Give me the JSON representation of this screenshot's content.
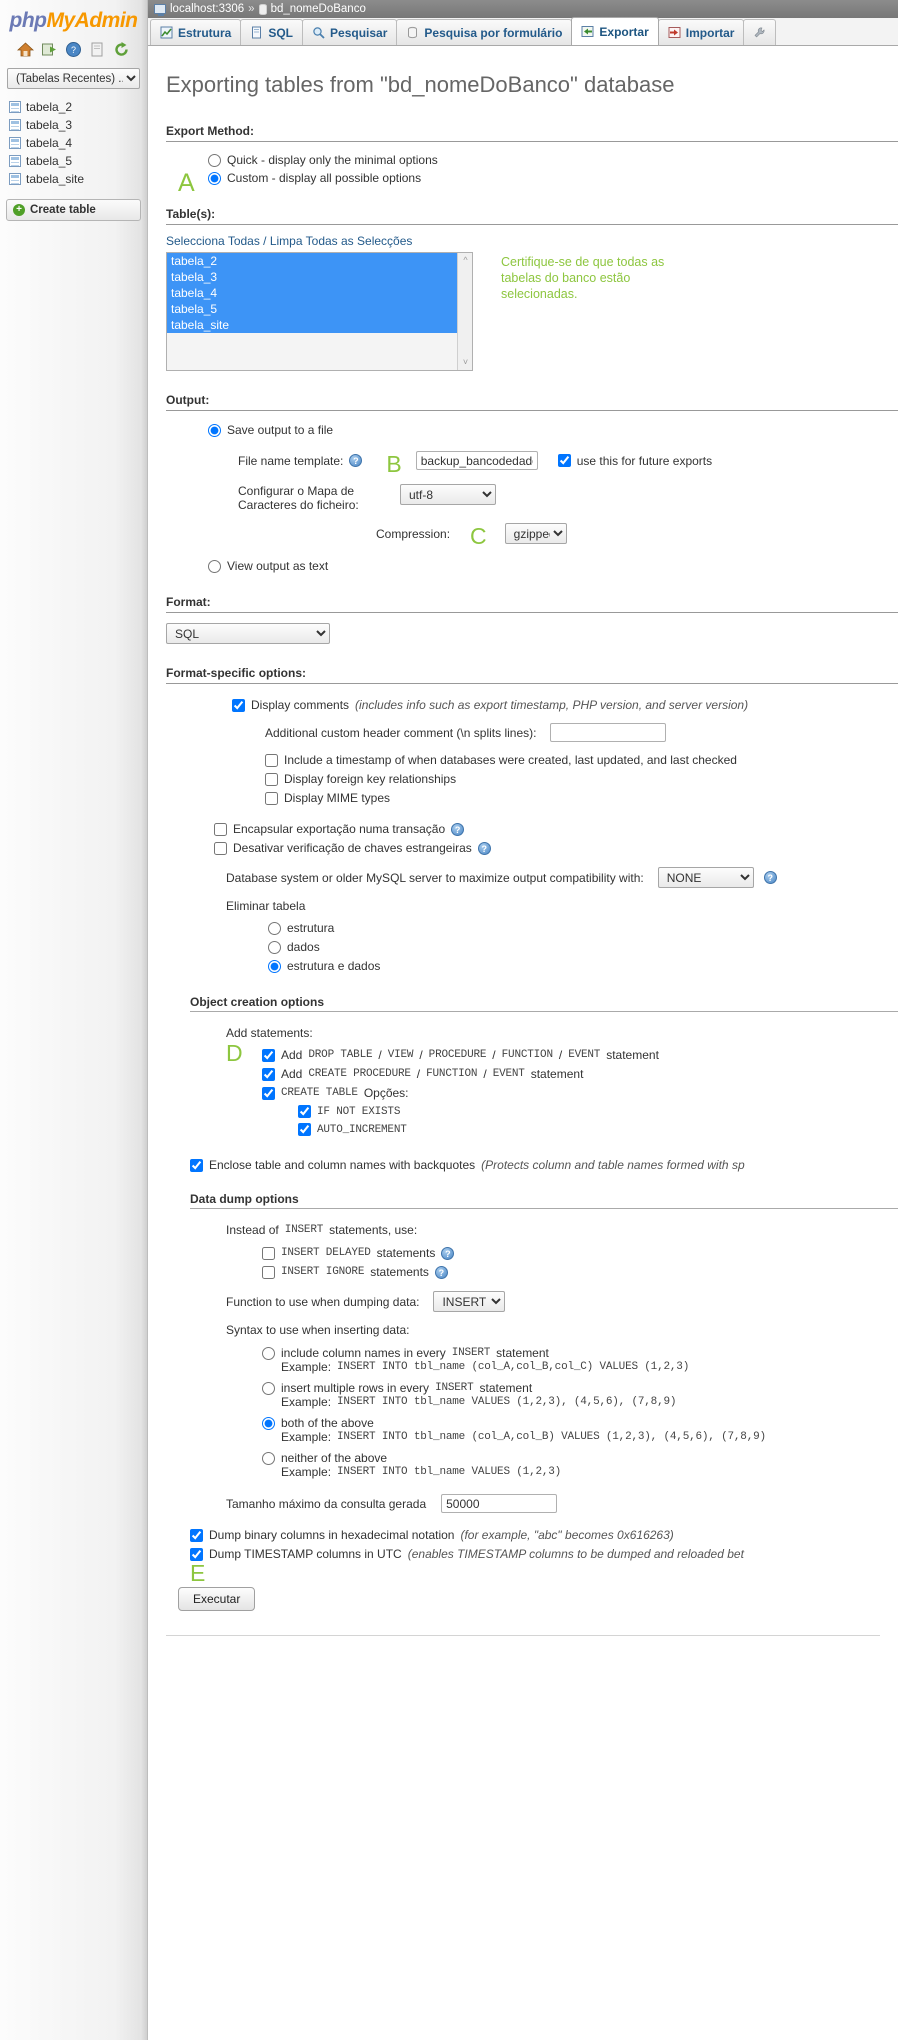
{
  "sidebar": {
    "logo": {
      "php": "php",
      "my": "My",
      "admin": "Admin"
    },
    "nav_icons": [
      "home-icon",
      "logout-icon",
      "help-icon",
      "docs-icon",
      "reload-icon"
    ],
    "recent_select": "(Tabelas Recentes) ...",
    "tables": [
      "tabela_2",
      "tabela_3",
      "tabela_4",
      "tabela_5",
      "tabela_site"
    ],
    "create_table": "Create table"
  },
  "breadcrumb": {
    "server": "localhost:3306",
    "separator": "»",
    "database": "bd_nomeDoBanco"
  },
  "tabs": [
    {
      "label": "Estrutura",
      "icon": "structure-icon",
      "active": false
    },
    {
      "label": "SQL",
      "icon": "sql-icon",
      "active": false
    },
    {
      "label": "Pesquisar",
      "icon": "search-icon",
      "active": false
    },
    {
      "label": "Pesquisa por formulário",
      "icon": "query-form-icon",
      "active": false
    },
    {
      "label": "Exportar",
      "icon": "export-icon",
      "active": true
    },
    {
      "label": "Importar",
      "icon": "import-icon",
      "active": false
    }
  ],
  "page_title": "Exporting tables from \"bd_nomeDoBanco\" database",
  "export_method": {
    "heading": "Export Method:",
    "quick": "Quick - display only the minimal options",
    "custom": "Custom - display all possible options",
    "selected": "custom"
  },
  "tables_section": {
    "heading": "Table(s):",
    "select_all_link": "Selecciona Todas / Limpa Todas as Selecções",
    "options": [
      "tabela_2",
      "tabela_3",
      "tabela_4",
      "tabela_5",
      "tabela_site"
    ],
    "annotation": "Certifique-se de que todas as tabelas do banco estão selecionadas."
  },
  "output": {
    "heading": "Output:",
    "save_to_file": "Save output to a file",
    "file_name_template_label": "File name template:",
    "file_name_template_value": "backup_bancodedados",
    "use_future": "use this for future exports",
    "charset_label": "Configurar o Mapa de Caracteres do ficheiro:",
    "charset_value": "utf-8",
    "compression_label": "Compression:",
    "compression_value": "gzipped",
    "view_as_text": "View output as text"
  },
  "format": {
    "heading": "Format:",
    "value": "SQL"
  },
  "format_specific": {
    "heading": "Format-specific options:",
    "display_comments": "Display comments",
    "display_comments_note": "(includes info such as export timestamp, PHP version, and server version)",
    "additional_header_label": "Additional custom header comment (\\n splits lines):",
    "additional_header_value": "",
    "include_timestamp": "Include a timestamp of when databases were created, last updated, and last checked",
    "foreign_key": "Display foreign key relationships",
    "mime_types": "Display MIME types",
    "encapsular": "Encapsular exportação numa transação",
    "desativar": "Desativar verificação de chaves estrangeiras",
    "compat_label": "Database system or older MySQL server to maximize output compatibility with:",
    "compat_value": "NONE",
    "eliminar_tabela": "Eliminar tabela",
    "estrutura": "estrutura",
    "dados": "dados",
    "estrutura_e_dados": "estrutura e dados",
    "eliminar_selected": "estrutura e dados"
  },
  "object_creation": {
    "heading": "Object creation options",
    "add_statements": "Add statements:",
    "drop_pre": "Add",
    "drop_mono1": "DROP TABLE",
    "drop_sep1": "/",
    "drop_mono2": "VIEW",
    "drop_sep2": "/",
    "drop_mono3": "PROCEDURE",
    "drop_sep3": "/",
    "drop_mono4": "FUNCTION",
    "drop_sep4": "/",
    "drop_mono5": "EVENT",
    "drop_post": "statement",
    "create_pre": "Add",
    "create_mono1": "CREATE PROCEDURE",
    "create_sep1": "/",
    "create_mono2": "FUNCTION",
    "create_sep2": "/",
    "create_mono3": "EVENT",
    "create_post": "statement",
    "create_table_opts_mono": "CREATE TABLE",
    "create_table_opts_post": "Opções:",
    "if_not_exists": "IF NOT EXISTS",
    "auto_increment": "AUTO_INCREMENT",
    "backquotes": "Enclose table and column names with backquotes",
    "backquotes_note": "(Protects column and table names formed with sp"
  },
  "data_dump": {
    "heading": "Data dump options",
    "instead_pre": "Instead of",
    "instead_mono": "INSERT",
    "instead_post": "statements, use:",
    "delayed_mono": "INSERT DELAYED",
    "delayed_post": "statements",
    "ignore_mono": "INSERT IGNORE",
    "ignore_post": "statements",
    "function_label": "Function to use when dumping data:",
    "function_value": "INSERT",
    "syntax_label": "Syntax to use when inserting data:",
    "opt1_pre": "include column names in every",
    "opt1_mono": "INSERT",
    "opt1_post": "statement",
    "opt1_example_pre": "Example:",
    "opt1_example": "INSERT INTO tbl_name (col_A,col_B,col_C) VALUES (1,2,3)",
    "opt2_pre": "insert multiple rows in every",
    "opt2_mono": "INSERT",
    "opt2_post": "statement",
    "opt2_example_pre": "Example:",
    "opt2_example": "INSERT INTO tbl_name VALUES (1,2,3), (4,5,6), (7,8,9)",
    "opt3": "both of the above",
    "opt3_example_pre": "Example:",
    "opt3_example": "INSERT INTO tbl_name (col_A,col_B) VALUES (1,2,3), (4,5,6), (7,8,9)",
    "opt4": "neither of the above",
    "opt4_example_pre": "Example:",
    "opt4_example": "INSERT INTO tbl_name VALUES (1,2,3)",
    "selected": "both of the above",
    "max_query_label": "Tamanho máximo da consulta gerada",
    "max_query_value": "50000",
    "hex_binary": "Dump binary columns in hexadecimal notation",
    "hex_binary_note": "(for example, \"abc\" becomes 0x616263)",
    "utc_timestamp": "Dump TIMESTAMP columns in UTC",
    "utc_timestamp_note": "(enables TIMESTAMP columns to be dumped and reloaded bet"
  },
  "execute_button": "Executar",
  "annotations": {
    "A": "A",
    "B": "B",
    "C": "C",
    "D": "D",
    "E": "E"
  },
  "colors": {
    "annotation_green": "#8dc63f",
    "selection_blue": "#3d94f6",
    "link_blue": "#235a8a",
    "logo_purple": "#6c7ab5",
    "logo_orange": "#f79800"
  }
}
